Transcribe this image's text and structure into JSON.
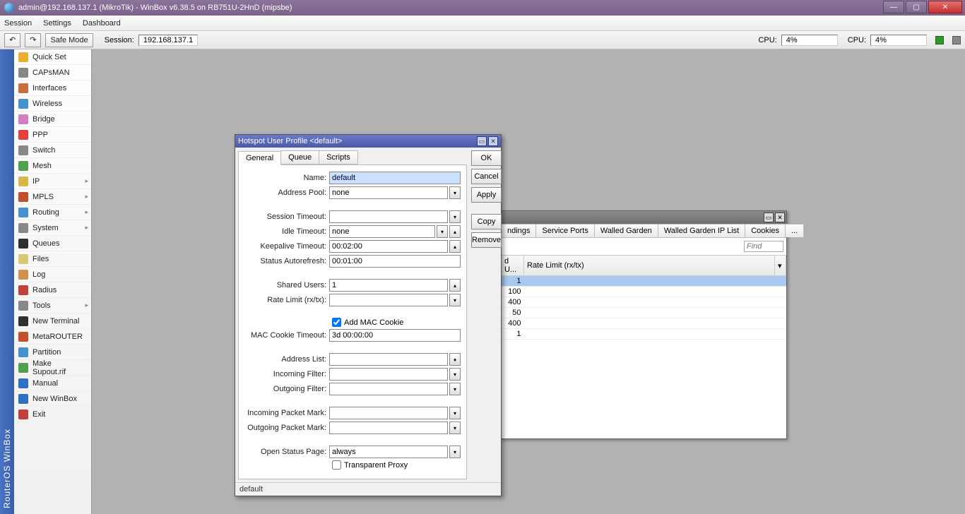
{
  "window": {
    "title": "admin@192.168.137.1 (MikroTik) - WinBox v6.38.5 on RB751U-2HnD (mipsbe)"
  },
  "menubar": [
    "Session",
    "Settings",
    "Dashboard"
  ],
  "toolbar": {
    "safe_mode": "Safe Mode",
    "session_label": "Session:",
    "session_value": "192.168.137.1",
    "cpu1_label": "CPU:",
    "cpu1_value": "4%",
    "cpu2_label": "CPU:",
    "cpu2_value": "4%"
  },
  "sidebar_title": "RouterOS WinBox",
  "sidebar": [
    {
      "label": "Quick Set",
      "color": "#e8b030"
    },
    {
      "label": "CAPsMAN",
      "color": "#888"
    },
    {
      "label": "Interfaces",
      "color": "#c97040"
    },
    {
      "label": "Wireless",
      "color": "#4a90d0"
    },
    {
      "label": "Bridge",
      "color": "#d080c0"
    },
    {
      "label": "PPP",
      "color": "#e04040"
    },
    {
      "label": "Switch",
      "color": "#888"
    },
    {
      "label": "Mesh",
      "color": "#50a050"
    },
    {
      "label": "IP",
      "color": "#d8b848",
      "arrow": true
    },
    {
      "label": "MPLS",
      "color": "#c05030",
      "arrow": true
    },
    {
      "label": "Routing",
      "color": "#4a90d0",
      "arrow": true
    },
    {
      "label": "System",
      "color": "#888",
      "arrow": true
    },
    {
      "label": "Queues",
      "color": "#303030"
    },
    {
      "label": "Files",
      "color": "#d8c878"
    },
    {
      "label": "Log",
      "color": "#d09050"
    },
    {
      "label": "Radius",
      "color": "#c04040"
    },
    {
      "label": "Tools",
      "color": "#888",
      "arrow": true
    },
    {
      "label": "New Terminal",
      "color": "#303030"
    },
    {
      "label": "MetaROUTER",
      "color": "#c05030"
    },
    {
      "label": "Partition",
      "color": "#4a90d0"
    },
    {
      "label": "Make Supout.rif",
      "color": "#50a050"
    },
    {
      "label": "Manual",
      "color": "#3070c0"
    },
    {
      "label": "New WinBox",
      "color": "#3070c0"
    },
    {
      "label": "Exit",
      "color": "#c04040"
    }
  ],
  "bgwin": {
    "tabs": [
      "ndings",
      "Service Ports",
      "Walled Garden",
      "Walled Garden IP List",
      "Cookies",
      "..."
    ],
    "find_placeholder": "Find",
    "cols": [
      "d U...",
      "Rate Limit (rx/tx)"
    ],
    "rows": [
      {
        "u": "1",
        "rate": ""
      },
      {
        "u": "100",
        "rate": ""
      },
      {
        "u": "400",
        "rate": ""
      },
      {
        "u": "50",
        "rate": ""
      },
      {
        "u": "400",
        "rate": ""
      },
      {
        "u": "1",
        "rate": ""
      }
    ]
  },
  "dialog": {
    "title": "Hotspot User Profile <default>",
    "tabs": [
      "General",
      "Queue",
      "Scripts"
    ],
    "buttons": {
      "ok": "OK",
      "cancel": "Cancel",
      "apply": "Apply",
      "copy": "Copy",
      "remove": "Remove"
    },
    "fields": {
      "name_label": "Name:",
      "name_value": "default",
      "pool_label": "Address Pool:",
      "pool_value": "none",
      "sess_label": "Session Timeout:",
      "sess_value": "",
      "idle_label": "Idle Timeout:",
      "idle_value": "none",
      "keep_label": "Keepalive Timeout:",
      "keep_value": "00:02:00",
      "auto_label": "Status Autorefresh:",
      "auto_value": "00:01:00",
      "shared_label": "Shared Users:",
      "shared_value": "1",
      "rate_label": "Rate Limit (rx/tx):",
      "rate_value": "",
      "addmac_label": "Add MAC Cookie",
      "mact_label": "MAC Cookie Timeout:",
      "mact_value": "3d 00:00:00",
      "alist_label": "Address List:",
      "alist_value": "",
      "infilt_label": "Incoming Filter:",
      "infilt_value": "",
      "outfilt_label": "Outgoing Filter:",
      "outfilt_value": "",
      "inpkt_label": "Incoming Packet Mark:",
      "inpkt_value": "",
      "outpkt_label": "Outgoing Packet Mark:",
      "outpkt_value": "",
      "open_label": "Open Status Page:",
      "open_value": "always",
      "tproxy_label": "Transparent Proxy"
    },
    "status": "default"
  }
}
